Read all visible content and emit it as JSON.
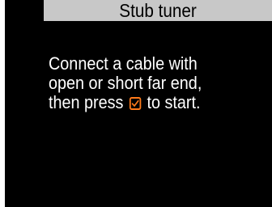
{
  "title_bar": {
    "label": "Stub tuner"
  },
  "message": {
    "line1": "Connect a cable with",
    "line2": "open or short far end,",
    "line3_before_icon": "then press ",
    "line3_after_icon": " to start.",
    "icon": "orange-checkbox-icon"
  },
  "colors": {
    "screen_background": "#000000",
    "title_background": "#c8c8c8",
    "title_text": "#000000",
    "message_text": "#ffffff",
    "check_icon": "#ff7a1a"
  }
}
